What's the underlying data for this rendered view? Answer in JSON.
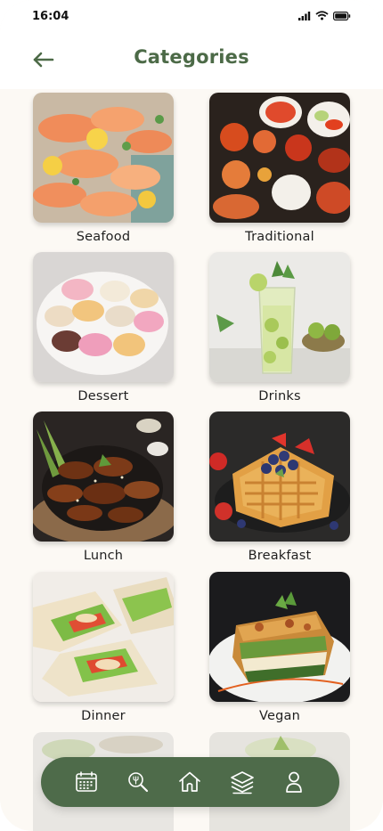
{
  "status_bar": {
    "time": "16:04"
  },
  "header": {
    "title": "Categories",
    "back_icon": "arrow-left-icon"
  },
  "categories": [
    {
      "label": "Seafood"
    },
    {
      "label": "Traditional"
    },
    {
      "label": "Dessert"
    },
    {
      "label": "Drinks"
    },
    {
      "label": "Lunch"
    },
    {
      "label": "Breakfast"
    },
    {
      "label": "Dinner"
    },
    {
      "label": "Vegan"
    }
  ],
  "bottom_nav": {
    "items": [
      {
        "icon": "calendar-icon"
      },
      {
        "icon": "search-recipe-icon"
      },
      {
        "icon": "home-icon"
      },
      {
        "icon": "layers-icon",
        "active": true
      },
      {
        "icon": "profile-icon"
      }
    ]
  },
  "colors": {
    "accent": "#4c6a47",
    "nav_bg": "#4e6b4a",
    "background": "#fcf9f4"
  }
}
